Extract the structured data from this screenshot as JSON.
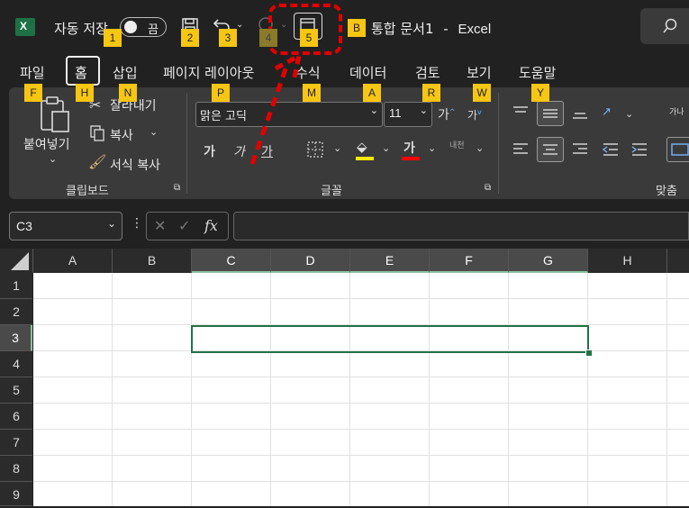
{
  "titlebar": {
    "autosave_label": "자동 저장",
    "toggle_state": "끔",
    "doc_title": "통합 문서1",
    "app_sep": "-",
    "app_name": "Excel",
    "excel_logo_letter": "X"
  },
  "keytips": {
    "qat": [
      "1",
      "2",
      "3",
      "4",
      "5",
      "B"
    ],
    "tabs": [
      "F",
      "H",
      "N",
      "P",
      "M",
      "A",
      "R",
      "W",
      "Y"
    ]
  },
  "tabs": [
    "파일",
    "홈",
    "삽입",
    "페이지 레이아웃",
    "수식",
    "데이터",
    "검토",
    "보기",
    "도움말"
  ],
  "ribbon": {
    "paste_label": "붙여넣기",
    "cut_label": "잘라내기",
    "copy_label": "복사",
    "format_painter_label": "서식 복사",
    "clipboard_group": "클립보드",
    "font_name": "맑은 고딕",
    "font_size": "11",
    "font_group": "글꼴",
    "align_group": "맞춤",
    "grow_font": "가",
    "shrink_font": "가",
    "bold": "가",
    "italic": "가",
    "underline": "가",
    "font_color_glyph": "가",
    "phonetic_glyph": "내천",
    "wrap_glyph": "가나"
  },
  "formula_bar": {
    "name_box": "C3",
    "fx": "fx",
    "value": ""
  },
  "columns": [
    "A",
    "B",
    "C",
    "D",
    "E",
    "F",
    "G",
    "H"
  ],
  "rows": [
    "1",
    "2",
    "3",
    "4",
    "5",
    "6",
    "7",
    "8",
    "9"
  ],
  "selected_cell": "C3",
  "colors": {
    "accent": "#217346",
    "keytip": "#f7c613",
    "highlight": "#ff0000"
  }
}
